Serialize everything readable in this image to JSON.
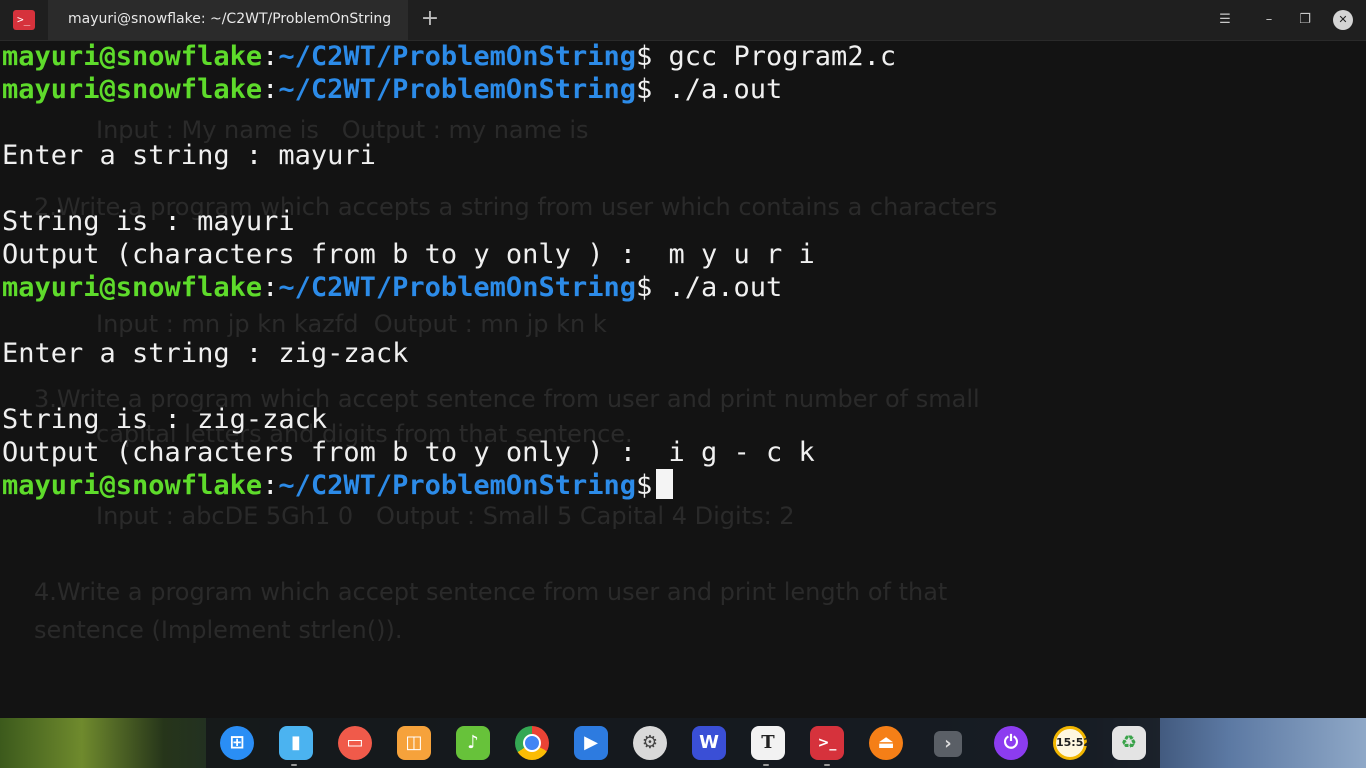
{
  "titlebar": {
    "tab_title": "mayuri@snowflake: ~/C2WT/ProblemOnString",
    "new_tab_icon": "+",
    "app_icon": ">_",
    "menu_icon": "☰",
    "minimize_icon": "–",
    "restore_icon": "❐",
    "close_icon": "✕"
  },
  "terminal": {
    "prompt_user": "mayuri@snowflake",
    "prompt_sep": ":",
    "prompt_path": "~/C2WT/ProblemOnString",
    "prompt_dollar": "$",
    "cmd1": " gcc Program2.c",
    "cmd2": " ./a.out",
    "out1": "Enter a string : mayuri",
    "out2": "String is : mayuri",
    "out3": "Output (characters from b to y only ) :  m y u r i",
    "cmd3": " ./a.out",
    "out4": "Enter a string : zig-zack",
    "out5": "String is : zig-zack",
    "out6": "Output (characters from b to y only ) :  i g - c k",
    "cmd4": " "
  },
  "background_doc": {
    "line1": "Input : My name is   Output : my name is",
    "line2": "2.Write a program which accepts a string from user which contains a characters",
    "line3": "Input : mn jp kn kazfd  Output : mn jp kn k",
    "line4": "3.Write a program which accept sentence from user and print number of small",
    "line5": "capital letters and digits from that sentence.",
    "line6": "Input : abcDE 5Gh1 0   Output : Small 5 Capital 4 Digits: 2",
    "line7": "4.Write a program which accept sentence from user and print length of that",
    "line8": "sentence (Implement strlen())."
  },
  "dock": {
    "items": [
      "launcher-icon",
      "file-manager-icon",
      "screen-recorder-icon",
      "app-store-icon",
      "music-icon",
      "chrome-icon",
      "video-player-icon",
      "settings-icon",
      "wps-writer-icon",
      "text-editor-icon",
      "terminal-icon",
      "media-player-icon",
      "expand-icon",
      "power-icon",
      "clock-icon",
      "trash-icon"
    ],
    "clock_text": "15:52",
    "text_editor_glyph": "T",
    "writer_glyph": "W",
    "expand_glyph": "›"
  },
  "colors": {
    "user": "#5edb2b",
    "path": "#2c8be8",
    "text": "#f0f0f0",
    "background": "#131313"
  }
}
